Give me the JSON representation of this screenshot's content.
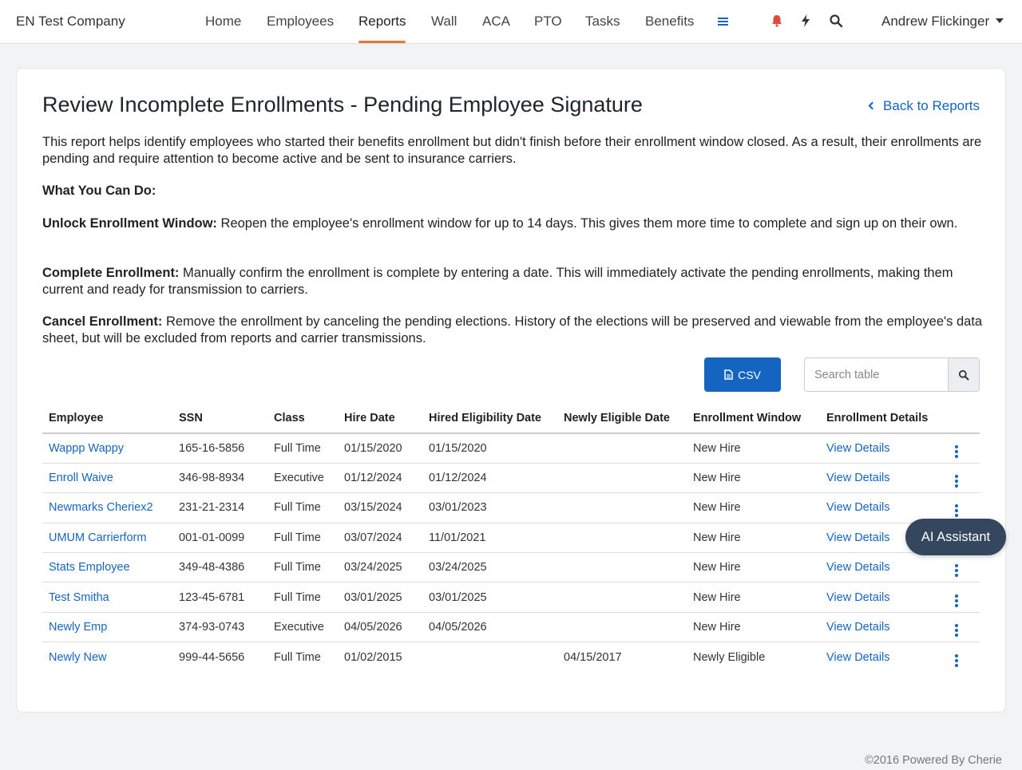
{
  "header": {
    "company": "EN Test Company",
    "nav": [
      "Home",
      "Employees",
      "Reports",
      "Wall",
      "ACA",
      "PTO",
      "Tasks",
      "Benefits"
    ],
    "active_nav": "Reports",
    "icons": [
      "menu-icon",
      "bell-icon",
      "bolt-icon",
      "search-icon"
    ],
    "user": "Andrew Flickinger"
  },
  "page": {
    "title": "Review Incomplete Enrollments - Pending Employee Signature",
    "back_link": "Back to Reports",
    "intro": "This report helps identify employees who started their benefits enrollment but didn't finish before their enrollment window closed. As a result, their enrollments are pending and require attention to become active and be sent to insurance carriers.",
    "what_heading": "What You Can Do:",
    "unlock_label": "Unlock Enrollment Window:",
    "unlock_text": " Reopen the employee's enrollment window for up to 14 days. This gives them more time to complete and sign up on their own.",
    "complete_label": "Complete Enrollment:",
    "complete_text": " Manually confirm the enrollment is complete by entering a date. This will immediately activate the pending enrollments, making them current and ready for transmission to carriers.",
    "cancel_label": "Cancel Enrollment:",
    "cancel_text": " Remove the enrollment by canceling the pending elections. History of the elections will be preserved and viewable from the employee's data sheet, but will be excluded from reports and carrier transmissions."
  },
  "toolbar": {
    "csv_label": "CSV",
    "search_placeholder": "Search table"
  },
  "table": {
    "columns": [
      "Employee",
      "SSN",
      "Class",
      "Hire Date",
      "Hired Eligibility Date",
      "Newly Eligible Date",
      "Enrollment Window",
      "Enrollment Details"
    ],
    "rows": [
      [
        "Wappp Wappy",
        "165-16-5856",
        "Full Time",
        "01/15/2020",
        "01/15/2020",
        "",
        "New Hire",
        "View Details"
      ],
      [
        "Enroll Waive",
        "346-98-8934",
        "Executive",
        "01/12/2024",
        "01/12/2024",
        "",
        "New Hire",
        "View Details"
      ],
      [
        "Newmarks Cheriex2",
        "231-21-2314",
        "Full Time",
        "03/15/2024",
        "03/01/2023",
        "",
        "New Hire",
        "View Details"
      ],
      [
        "UMUM Carrierform",
        "001-01-0099",
        "Full Time",
        "03/07/2024",
        "11/01/2021",
        "",
        "New Hire",
        "View Details"
      ],
      [
        "Stats Employee",
        "349-48-4386",
        "Full Time",
        "03/24/2025",
        "03/24/2025",
        "",
        "New Hire",
        "View Details"
      ],
      [
        "Test Smitha",
        "123-45-6781",
        "Full Time",
        "03/01/2025",
        "03/01/2025",
        "",
        "New Hire",
        "View Details"
      ],
      [
        "Newly Emp",
        "374-93-0743",
        "Executive",
        "04/05/2026",
        "04/05/2026",
        "",
        "New Hire",
        "View Details"
      ],
      [
        "Newly New",
        "999-44-5656",
        "Full Time",
        "01/02/2015",
        "",
        "04/15/2017",
        "Newly Eligible",
        "View Details"
      ]
    ]
  },
  "ai_assistant": "AI Assistant",
  "footer": "©2016 Powered By Cherie",
  "colors": {
    "accent": "#1565c0",
    "nav_underline": "#e07b39",
    "bell": "#e04a3f",
    "ai_button": "#34475f"
  }
}
